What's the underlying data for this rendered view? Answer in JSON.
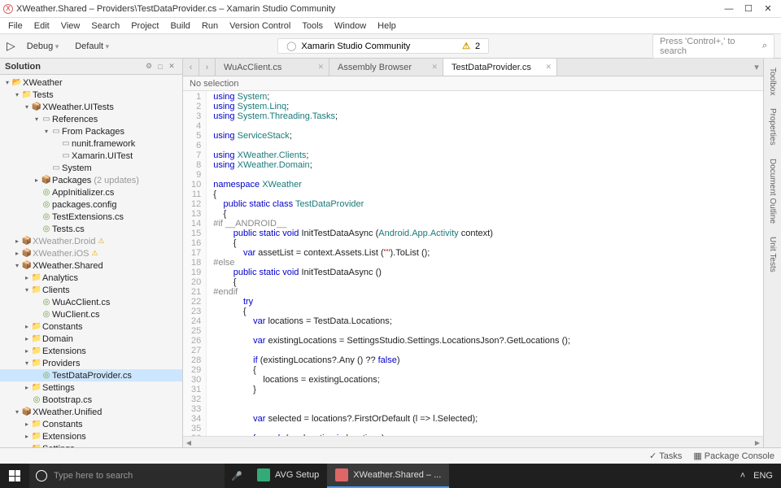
{
  "window": {
    "title": "XWeather.Shared – Providers\\TestDataProvider.cs – Xamarin Studio Community"
  },
  "menu": [
    "File",
    "Edit",
    "View",
    "Search",
    "Project",
    "Build",
    "Run",
    "Version Control",
    "Tools",
    "Window",
    "Help"
  ],
  "toolbar": {
    "config": "Debug",
    "target": "Default",
    "status_text": "Xamarin Studio Community",
    "warn_count": "2",
    "search_placeholder": "Press 'Control+,' to search"
  },
  "solution_panel": {
    "title": "Solution"
  },
  "tree": [
    {
      "d": 0,
      "exp": "▾",
      "ico": "📂",
      "cls": "folder",
      "lbl": "XWeather"
    },
    {
      "d": 1,
      "exp": "▾",
      "ico": "📁",
      "cls": "folder",
      "lbl": "Tests"
    },
    {
      "d": 2,
      "exp": "▾",
      "ico": "📦",
      "cls": "folder",
      "lbl": "XWeather.UITests"
    },
    {
      "d": 3,
      "exp": "▾",
      "ico": "▭",
      "cls": "reffile",
      "lbl": "References"
    },
    {
      "d": 4,
      "exp": "▾",
      "ico": "▭",
      "cls": "reffile",
      "lbl": "From Packages"
    },
    {
      "d": 5,
      "exp": "",
      "ico": "▭",
      "cls": "reffile",
      "lbl": "nunit.framework"
    },
    {
      "d": 5,
      "exp": "",
      "ico": "▭",
      "cls": "reffile",
      "lbl": "Xamarin.UITest"
    },
    {
      "d": 4,
      "exp": "",
      "ico": "▭",
      "cls": "reffile",
      "lbl": "System"
    },
    {
      "d": 3,
      "exp": "▸",
      "ico": "📦",
      "cls": "folder",
      "lbl": "Packages",
      "suffix": "(2 updates)"
    },
    {
      "d": 3,
      "exp": "",
      "ico": "◎",
      "cls": "csfile",
      "lbl": "AppInitializer.cs"
    },
    {
      "d": 3,
      "exp": "",
      "ico": "◎",
      "cls": "csfile",
      "lbl": "packages.config"
    },
    {
      "d": 3,
      "exp": "",
      "ico": "◎",
      "cls": "csfile",
      "lbl": "TestExtensions.cs"
    },
    {
      "d": 3,
      "exp": "",
      "ico": "◎",
      "cls": "csfile",
      "lbl": "Tests.cs"
    },
    {
      "d": 1,
      "exp": "▸",
      "ico": "📦",
      "cls": "folder dim",
      "lbl": "XWeather.Droid",
      "warn": true
    },
    {
      "d": 1,
      "exp": "▸",
      "ico": "📦",
      "cls": "folder dim",
      "lbl": "XWeather.iOS",
      "warn": true
    },
    {
      "d": 1,
      "exp": "▾",
      "ico": "📦",
      "cls": "folder",
      "lbl": "XWeather.Shared"
    },
    {
      "d": 2,
      "exp": "▸",
      "ico": "📁",
      "cls": "folder",
      "lbl": "Analytics"
    },
    {
      "d": 2,
      "exp": "▾",
      "ico": "📁",
      "cls": "folder",
      "lbl": "Clients"
    },
    {
      "d": 3,
      "exp": "",
      "ico": "◎",
      "cls": "csfile",
      "lbl": "WuAcClient.cs"
    },
    {
      "d": 3,
      "exp": "",
      "ico": "◎",
      "cls": "csfile",
      "lbl": "WuClient.cs"
    },
    {
      "d": 2,
      "exp": "▸",
      "ico": "📁",
      "cls": "folder",
      "lbl": "Constants"
    },
    {
      "d": 2,
      "exp": "▸",
      "ico": "📁",
      "cls": "folder",
      "lbl": "Domain"
    },
    {
      "d": 2,
      "exp": "▸",
      "ico": "📁",
      "cls": "folder",
      "lbl": "Extensions"
    },
    {
      "d": 2,
      "exp": "▾",
      "ico": "📁",
      "cls": "folder",
      "lbl": "Providers"
    },
    {
      "d": 3,
      "exp": "",
      "ico": "◎",
      "cls": "csfile",
      "lbl": "TestDataProvider.cs",
      "sel": true
    },
    {
      "d": 2,
      "exp": "▸",
      "ico": "📁",
      "cls": "folder",
      "lbl": "Settings"
    },
    {
      "d": 2,
      "exp": "",
      "ico": "◎",
      "cls": "csfile",
      "lbl": "Bootstrap.cs"
    },
    {
      "d": 1,
      "exp": "▾",
      "ico": "📦",
      "cls": "folder",
      "lbl": "XWeather.Unified"
    },
    {
      "d": 2,
      "exp": "▸",
      "ico": "📁",
      "cls": "folder",
      "lbl": "Constants"
    },
    {
      "d": 2,
      "exp": "▸",
      "ico": "📁",
      "cls": "folder",
      "lbl": "Extensions"
    },
    {
      "d": 2,
      "exp": "▸",
      "ico": "📁",
      "cls": "folder",
      "lbl": "Settings"
    }
  ],
  "tabs": [
    {
      "label": "WuAcClient.cs",
      "active": false
    },
    {
      "label": "Assembly Browser",
      "active": false
    },
    {
      "label": "TestDataProvider.cs",
      "active": true
    }
  ],
  "breadcrumb": "No selection",
  "code_lines": [
    [
      [
        "kw",
        "using"
      ],
      [
        "",
        " "
      ],
      [
        "typ",
        "System"
      ],
      [
        "",
        ";"
      ]
    ],
    [
      [
        "kw",
        "using"
      ],
      [
        "",
        " "
      ],
      [
        "typ",
        "System.Linq"
      ],
      [
        "",
        ";"
      ]
    ],
    [
      [
        "kw",
        "using"
      ],
      [
        "",
        " "
      ],
      [
        "typ",
        "System.Threading.Tasks"
      ],
      [
        "",
        ";"
      ]
    ],
    [
      [
        "",
        ""
      ]
    ],
    [
      [
        "kw",
        "using"
      ],
      [
        "",
        " "
      ],
      [
        "typ",
        "ServiceStack"
      ],
      [
        "",
        ";"
      ]
    ],
    [
      [
        "",
        ""
      ]
    ],
    [
      [
        "kw",
        "using"
      ],
      [
        "",
        " "
      ],
      [
        "typ",
        "XWeather.Clients"
      ],
      [
        "",
        ";"
      ]
    ],
    [
      [
        "kw",
        "using"
      ],
      [
        "",
        " "
      ],
      [
        "typ",
        "XWeather.Domain"
      ],
      [
        "",
        ";"
      ]
    ],
    [
      [
        "",
        ""
      ]
    ],
    [
      [
        "kw",
        "namespace"
      ],
      [
        "",
        " "
      ],
      [
        "typ",
        "XWeather"
      ]
    ],
    [
      [
        "",
        "{"
      ]
    ],
    [
      [
        "",
        "    "
      ],
      [
        "kw",
        "public static class"
      ],
      [
        "",
        " "
      ],
      [
        "typ",
        "TestDataProvider"
      ]
    ],
    [
      [
        "",
        "    {"
      ]
    ],
    [
      [
        "pp",
        "#if __ANDROID__"
      ]
    ],
    [
      [
        "",
        "        "
      ],
      [
        "kw",
        "public static void"
      ],
      [
        "",
        " InitTestDataAsync ("
      ],
      [
        "typ",
        "Android.App.Activity"
      ],
      [
        "",
        " context)"
      ]
    ],
    [
      [
        "",
        "        {"
      ]
    ],
    [
      [
        "",
        "            "
      ],
      [
        "kw",
        "var"
      ],
      [
        "",
        " assetList = context.Assets.List ("
      ],
      [
        "str",
        "\"\""
      ],
      [
        "",
        ").ToList ();"
      ]
    ],
    [
      [
        "pp",
        "#else"
      ]
    ],
    [
      [
        "",
        "        "
      ],
      [
        "kw",
        "public static void"
      ],
      [
        "",
        " InitTestDataAsync ()"
      ]
    ],
    [
      [
        "",
        "        {"
      ]
    ],
    [
      [
        "pp",
        "#endif"
      ]
    ],
    [
      [
        "",
        "            "
      ],
      [
        "kw",
        "try"
      ]
    ],
    [
      [
        "",
        "            {"
      ]
    ],
    [
      [
        "",
        "                "
      ],
      [
        "kw",
        "var"
      ],
      [
        "",
        " locations = TestData.Locations;"
      ]
    ],
    [
      [
        "",
        ""
      ]
    ],
    [
      [
        "",
        "                "
      ],
      [
        "kw",
        "var"
      ],
      [
        "",
        " existingLocations = SettingsStudio.Settings.LocationsJson?.GetLocations ();"
      ]
    ],
    [
      [
        "",
        ""
      ]
    ],
    [
      [
        "",
        "                "
      ],
      [
        "kw",
        "if"
      ],
      [
        "",
        " (existingLocations?.Any () ?? "
      ],
      [
        "kw",
        "false"
      ],
      [
        "",
        ")"
      ]
    ],
    [
      [
        "",
        "                {"
      ]
    ],
    [
      [
        "",
        "                    locations = existingLocations;"
      ]
    ],
    [
      [
        "",
        "                }"
      ]
    ],
    [
      [
        "",
        ""
      ]
    ],
    [
      [
        "",
        ""
      ]
    ],
    [
      [
        "",
        "                "
      ],
      [
        "kw",
        "var"
      ],
      [
        "",
        " selected = locations?.FirstOrDefault (l => l.Selected);"
      ]
    ],
    [
      [
        "",
        ""
      ]
    ],
    [
      [
        "",
        "                "
      ],
      [
        "kw",
        "foreach"
      ],
      [
        "",
        " ("
      ],
      [
        "kw",
        "var"
      ],
      [
        "",
        " location "
      ],
      [
        "kw",
        "in"
      ],
      [
        "",
        " locations)"
      ]
    ]
  ],
  "rail": [
    "Toolbox",
    "Properties",
    "Document Outline",
    "Unit Tests"
  ],
  "statusbar": {
    "tasks": "Tasks",
    "pkg": "Package Console"
  },
  "taskbar": {
    "search_placeholder": "Type here to search",
    "apps": [
      {
        "label": "AVG Setup",
        "color": "#3a7",
        "active": false
      },
      {
        "label": "XWeather.Shared – ...",
        "color": "#d66",
        "active": true
      }
    ],
    "lang": "ENG"
  }
}
